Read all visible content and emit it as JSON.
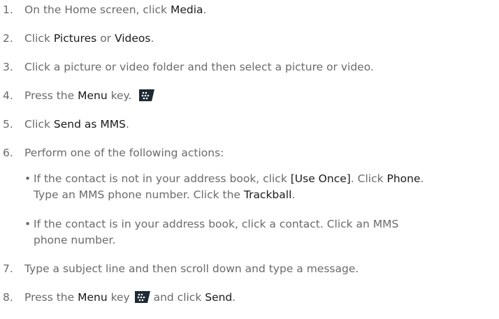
{
  "steps": [
    {
      "num": "1.",
      "t1": "On the Home screen, click ",
      "e1": "Media",
      "t2": "."
    },
    {
      "num": "2.",
      "t1": "Click ",
      "e1": "Pictures",
      "t2": " or ",
      "e2": "Videos",
      "t3": "."
    },
    {
      "num": "3.",
      "t1": "Click a picture or video folder and then select a picture or video."
    },
    {
      "num": "4.",
      "t1": "Press the ",
      "e1": "Menu",
      "t2": " key. "
    },
    {
      "num": "5.",
      "t1": "Click ",
      "e1": "Send as MMS",
      "t2": "."
    },
    {
      "num": "6.",
      "t1": "Perform one of the following actions:"
    },
    {
      "num": "7.",
      "t1": "Type a subject line and then scroll down and type a message."
    },
    {
      "num": "8.",
      "t1": "Press the ",
      "e1": "Menu",
      "t2": " key ",
      "t3": " and click ",
      "e2": "Send",
      "t4": "."
    }
  ],
  "bullets": [
    {
      "dot": "•",
      "l1a": "If the contact is not in your address book, click ",
      "l1b": "[Use Once]",
      "l1c": ". Click ",
      "l1d": "Phone",
      "l1e": ".",
      "l2a": "Type an MMS phone number. Click the ",
      "l2b": "Trackball",
      "l2c": "."
    },
    {
      "dot": "•",
      "l1a": "If the contact is in your address book, click a contact. Click an MMS",
      "l2a": "phone number."
    }
  ],
  "icons": {
    "menu_key": "blackberry-menu-key-icon",
    "menu_key_color": "#1e2a33"
  }
}
